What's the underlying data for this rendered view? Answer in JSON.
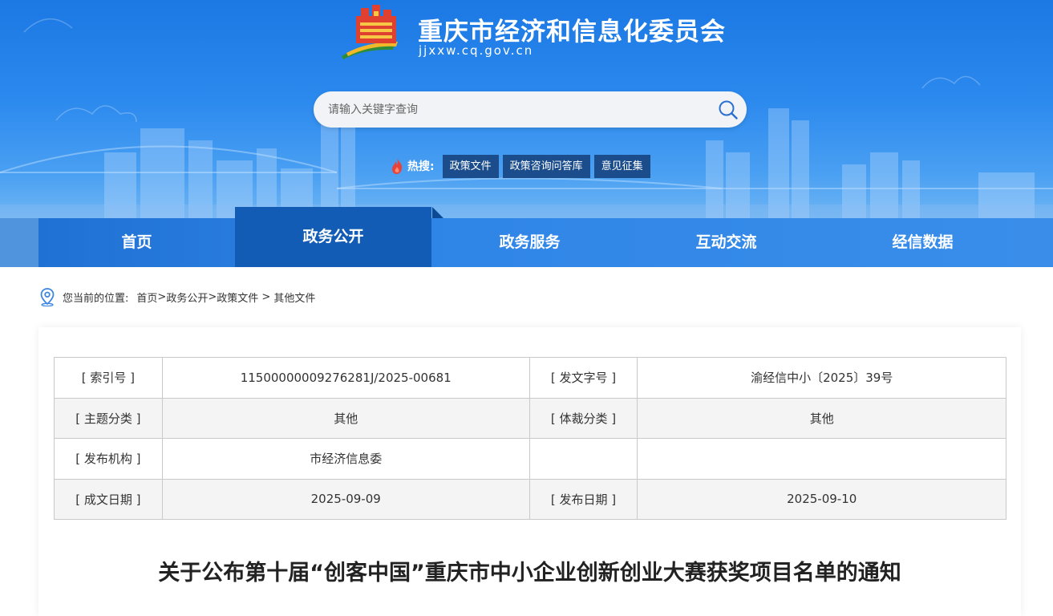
{
  "header": {
    "site_title": "重庆市经济和信息化委员会",
    "site_domain": "jjxxw.cq.gov.cn",
    "search_placeholder": "请输入关键字查询",
    "hot_label": "热搜:",
    "hot_tags": [
      "政策文件",
      "政策咨询问答库",
      "意见征集"
    ]
  },
  "nav": {
    "items": [
      "首页",
      "政务公开",
      "政务服务",
      "互动交流",
      "经信数据"
    ],
    "active_index": 1
  },
  "breadcrumb": {
    "prefix": "您当前的位置:",
    "items": [
      "首页",
      "政务公开",
      "政策文件",
      "其他文件"
    ],
    "separators": [
      ">",
      ">",
      " > "
    ]
  },
  "meta_table": {
    "rows": [
      [
        "[ 索引号 ]",
        "11500000009276281J/2025-00681",
        "[ 发文字号 ]",
        "渝经信中小〔2025〕39号"
      ],
      [
        "[ 主题分类 ]",
        "其他",
        "[ 体裁分类 ]",
        "其他"
      ],
      [
        "[ 发布机构 ]",
        "市经济信息委",
        "",
        ""
      ],
      [
        "[ 成文日期 ]",
        "2025-09-09",
        "[ 发布日期 ]",
        "2025-09-10"
      ]
    ]
  },
  "document": {
    "title": "关于公布第十届“创客中国”重庆市中小企业创新创业大赛获奖项目名单的通知"
  },
  "colors": {
    "header_blue": "#1c78e3",
    "nav_active": "#135cb5",
    "hot_tag_bg": "#1b4d8c",
    "fire_red": "#e8423a"
  }
}
